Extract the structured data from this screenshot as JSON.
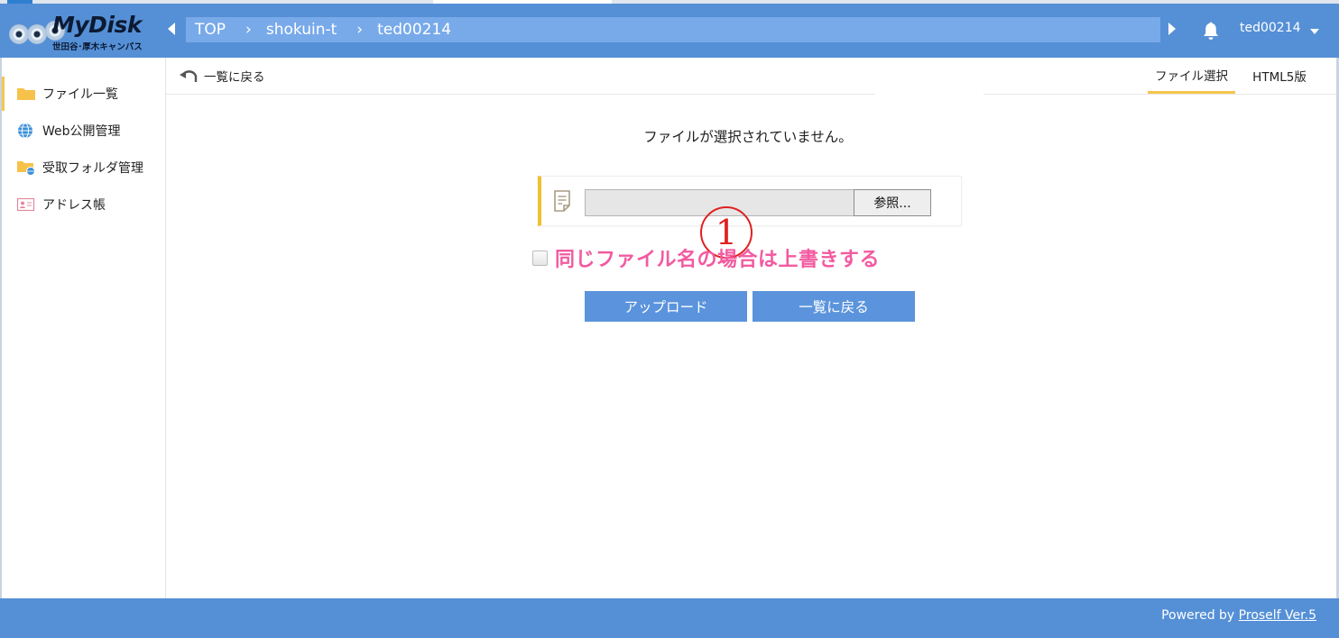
{
  "header": {
    "logo_text": "MyDisk",
    "logo_subtitle": "世田谷･厚木キャンパス",
    "breadcrumb": [
      "TOP",
      "shokuin-t",
      "ted00214"
    ],
    "breadcrumb_separator": "›",
    "user_name": "ted00214",
    "icons": [
      "chevron-left-icon",
      "chevron-right-icon",
      "bell-icon",
      "caret-down-icon"
    ]
  },
  "sidebar": {
    "items": [
      {
        "label": "ファイル一覧",
        "icon": "folder-icon",
        "active": true
      },
      {
        "label": "Web公開管理",
        "icon": "globe-icon",
        "active": false
      },
      {
        "label": "受取フォルダ管理",
        "icon": "folder-globe-icon",
        "active": false
      },
      {
        "label": "アドレス帳",
        "icon": "address-book-icon",
        "active": false
      }
    ]
  },
  "toolbar": {
    "back_label": "一覧に戻る",
    "tabs": [
      {
        "label": "ファイル選択",
        "active": true
      },
      {
        "label": "HTML5版",
        "active": false
      }
    ]
  },
  "upload": {
    "status_message": "ファイルが選択されていません。",
    "file_value": "",
    "browse_label": "参照...",
    "annotation_marker": "1",
    "overwrite_label": "同じファイル名の場合は上書きする",
    "overwrite_checked": false,
    "upload_button": "アップロード",
    "back_button": "一覧に戻る"
  },
  "footer": {
    "powered_prefix": "Powered by",
    "powered_link": "Proself Ver.5"
  },
  "colors": {
    "header_bg": "#5590d6",
    "breadcrumb_bg": "#78aaea",
    "accent": "#f6c64d",
    "button_bg": "#5b94dc",
    "overwrite_text": "#f25ba0",
    "marker": "#e02020"
  }
}
